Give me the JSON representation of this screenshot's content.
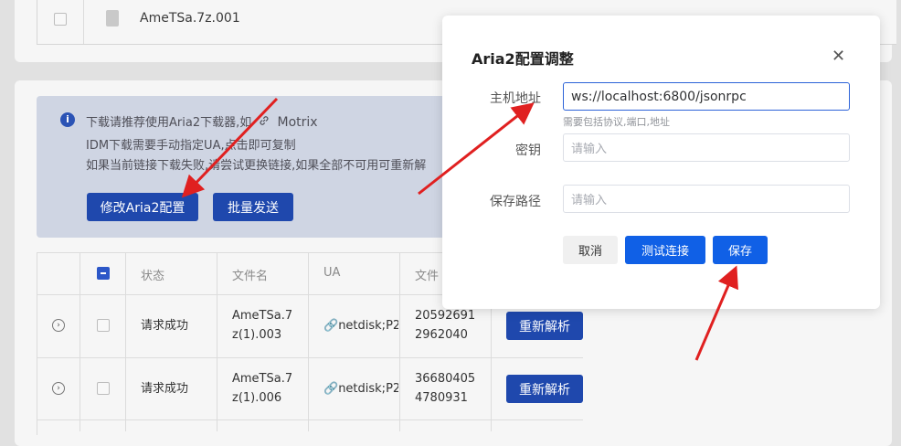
{
  "background": {
    "top_row": {
      "file_name": "AmeTSa.7z.001"
    },
    "info": {
      "line1_prefix": "下载请推荐使用Aria2下载器,如",
      "line1_link": "Motrix",
      "line2": "IDM下载需要手动指定UA,点击即可复制",
      "line3": "如果当前链接下载失败,请尝试更换链接,如果全部不可用可重新解"
    },
    "buttons": {
      "edit_aria2": "修改Aria2配置",
      "batch_send": "批量发送"
    },
    "table": {
      "headers": [
        "状态",
        "文件名",
        "UA",
        "文件"
      ],
      "rows": [
        {
          "status": "请求成功",
          "file_name_l1": "AmeTSa.7",
          "file_name_l2": "z(1).003",
          "ua": "netdisk;P2",
          "size_l1": "20592691",
          "size_l2": "2962040",
          "action": "重新解析"
        },
        {
          "status": "请求成功",
          "file_name_l1": "AmeTSa.7",
          "file_name_l2": "z(1).006",
          "ua": "netdisk;P2",
          "size_l1": "36680405",
          "size_l2": "4780931",
          "action": "重新解析"
        }
      ]
    }
  },
  "modal": {
    "title": "Aria2配置调整",
    "host_label": "主机地址",
    "host_value": "ws://localhost:6800/jsonrpc",
    "host_hint": "需要包括协议,端口,地址",
    "secret_label": "密钥",
    "secret_placeholder": "请输入",
    "path_label": "保存路径",
    "path_placeholder": "请输入",
    "cancel": "取消",
    "test": "测试连接",
    "save": "保存"
  },
  "icons": {
    "close": "close-icon",
    "info": "info-icon",
    "link": "link-icon",
    "expand": "expand-icon",
    "file": "file-icon"
  },
  "colors": {
    "primary": "#1060e6",
    "dark_button": "#1f48ad",
    "arrow": "#e02020"
  }
}
